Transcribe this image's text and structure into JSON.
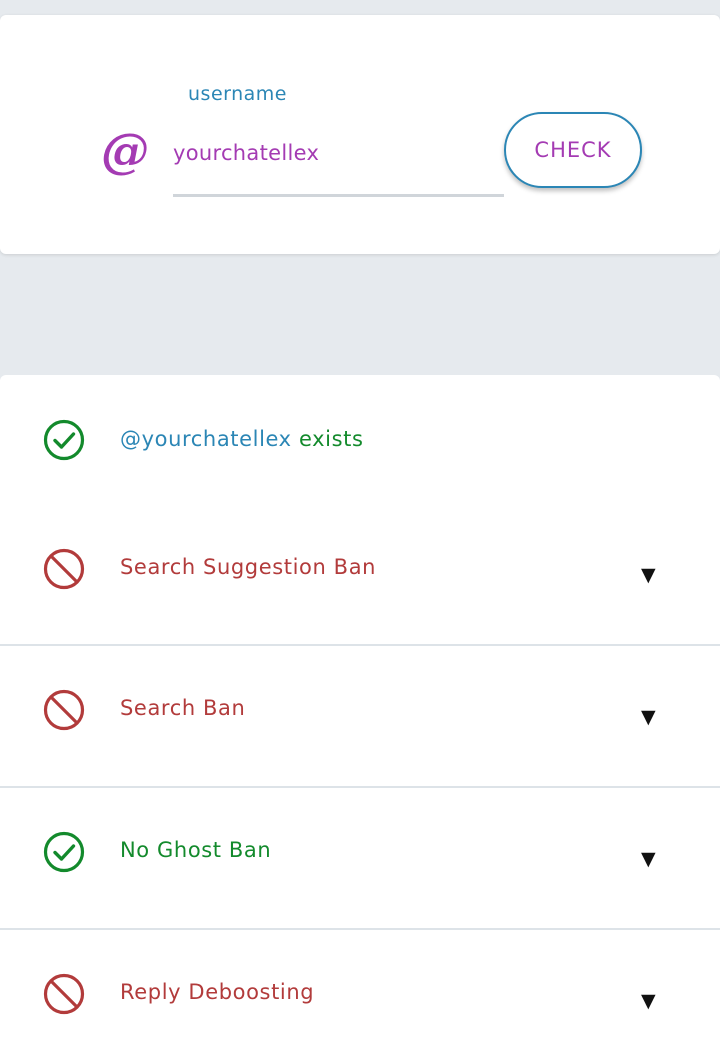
{
  "search": {
    "at_symbol": "@",
    "label": "username",
    "value": "yourchatellex",
    "button_label": "CHECK"
  },
  "results": {
    "exists": {
      "handle": "@yourchatellex",
      "suffix": " exists",
      "status": "ok"
    },
    "items": [
      {
        "label": "Search Suggestion Ban",
        "status": "banned",
        "expand_icon": "▼"
      },
      {
        "label": "Search Ban",
        "status": "banned",
        "expand_icon": "▼"
      },
      {
        "label": "No Ghost Ban",
        "status": "ok",
        "expand_icon": "▼"
      },
      {
        "label": "Reply Deboosting",
        "status": "banned",
        "expand_icon": "▼"
      }
    ]
  },
  "colors": {
    "accent_purple": "#a43bb3",
    "accent_blue": "#2b86b5",
    "ok_green": "#138a2c",
    "ban_red": "#b23b3b",
    "background": "#e6eaee"
  },
  "icons": {
    "at": "at-icon",
    "ok": "check-circle-icon",
    "banned": "prohibited-icon",
    "expand": "chevron-down-icon"
  }
}
